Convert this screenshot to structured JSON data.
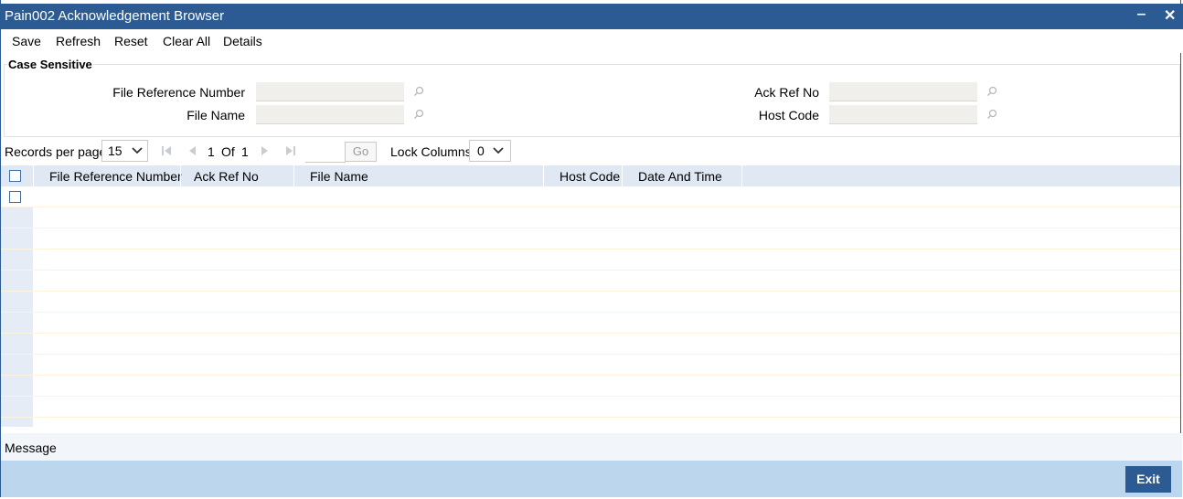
{
  "window": {
    "title": "Pain002 Acknowledgement Browser",
    "minimize": "‒",
    "close": "✕"
  },
  "toolbar": {
    "save": "Save",
    "refresh": "Refresh",
    "reset": "Reset",
    "clear_all": "Clear All",
    "details": "Details"
  },
  "search": {
    "legend": "Case Sensitive",
    "file_reference_number": {
      "label": "File Reference Number",
      "value": ""
    },
    "file_name": {
      "label": "File Name",
      "value": ""
    },
    "ack_ref_no": {
      "label": "Ack Ref No",
      "value": ""
    },
    "host_code": {
      "label": "Host Code",
      "value": ""
    }
  },
  "pager": {
    "records_per_page_label": "Records per page",
    "records_per_page_value": "15",
    "current_page": "1",
    "of_label": "Of",
    "total_pages": "1",
    "go_label": "Go",
    "lock_columns_label": "Lock Columns",
    "lock_columns_value": "0"
  },
  "table": {
    "columns": [
      "File Reference Number",
      "Ack Ref No",
      "File Name",
      "Host Code",
      "Date And Time"
    ],
    "rows": []
  },
  "message": {
    "label": "Message"
  },
  "footer": {
    "exit_label": "Exit"
  },
  "colors": {
    "titlebar": "#2c5b94",
    "header": "#dfe8f3",
    "footer": "#bcd6ed"
  },
  "icons": [
    "search-icon",
    "first-page-icon",
    "prev-page-icon",
    "next-page-icon",
    "last-page-icon",
    "chevron-down-icon"
  ]
}
